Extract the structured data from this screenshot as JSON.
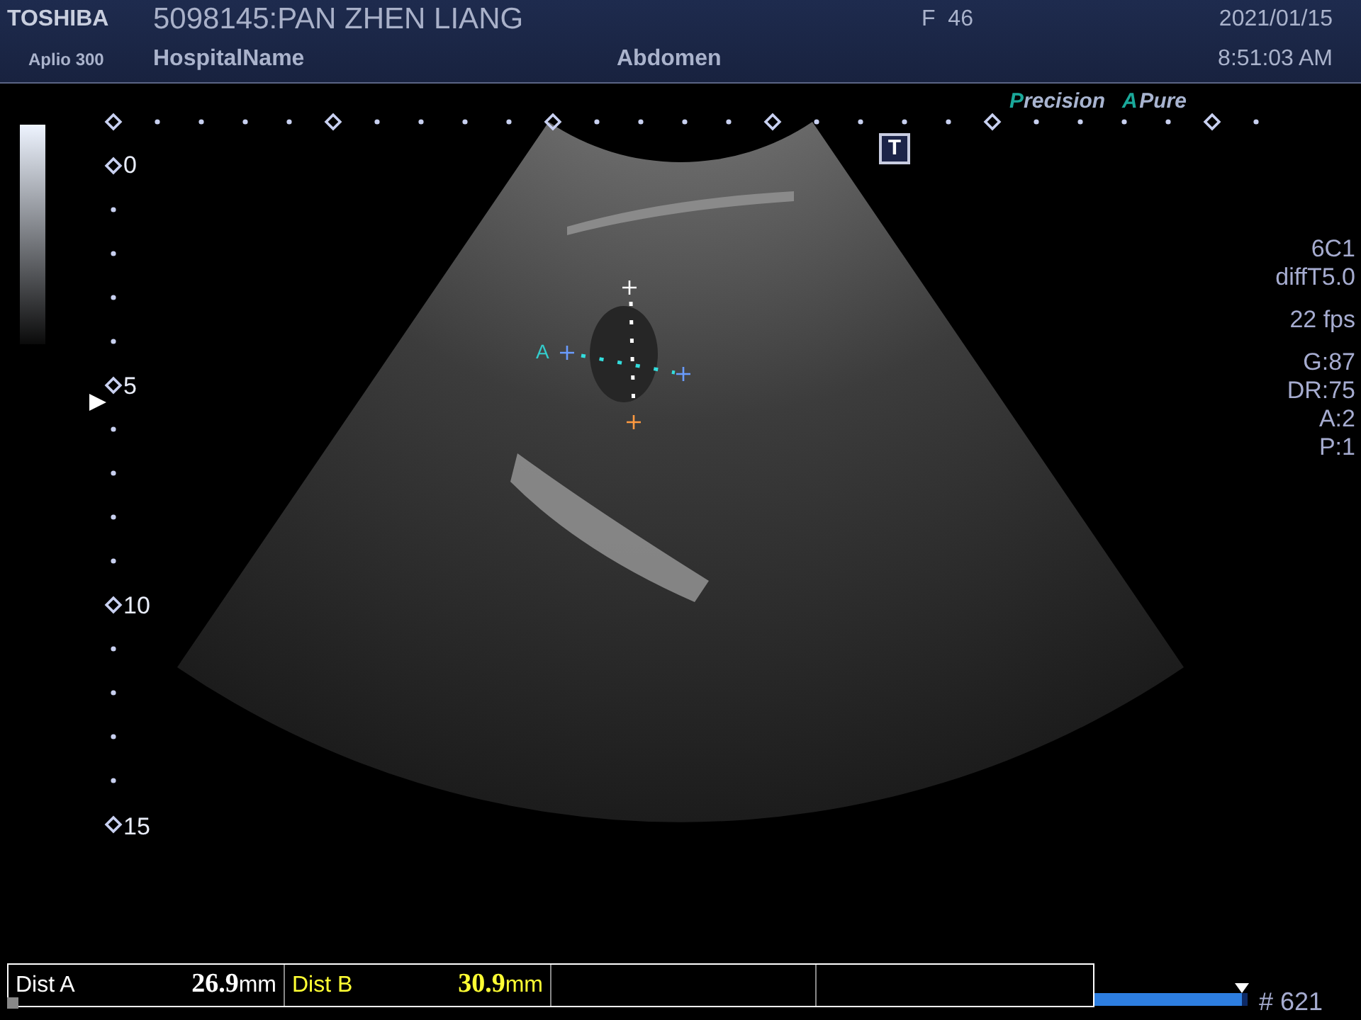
{
  "header": {
    "brand": "TOSHIBA",
    "model": "Aplio 300",
    "patient": "5098145:PAN ZHEN LIANG",
    "hospital": "HospitalName",
    "sex_age": "F  46",
    "exam": "Abdomen",
    "date": "2021/01/15",
    "time": "8:51:03 AM"
  },
  "modes": [
    {
      "initial": "P",
      "rest": "recision"
    },
    {
      "initial": "A",
      "rest": "Pure"
    }
  ],
  "t_marker": "T",
  "depth_labels": [
    "0",
    "5",
    "10",
    "15"
  ],
  "params": [
    [
      "6C1",
      "diffT5.0"
    ],
    [
      "22 fps"
    ],
    [
      "G:87",
      "DR:75",
      "A:2",
      "P:1"
    ]
  ],
  "caliper_label": "A",
  "measurements": [
    {
      "label": "Dist A",
      "value": "26.9",
      "unit": "mm",
      "color": "#ffffff"
    },
    {
      "label": "Dist B",
      "value": "30.9",
      "unit": "mm",
      "color": "#ffff33"
    }
  ],
  "cine": {
    "level": 0.96,
    "frame": "# 621"
  }
}
